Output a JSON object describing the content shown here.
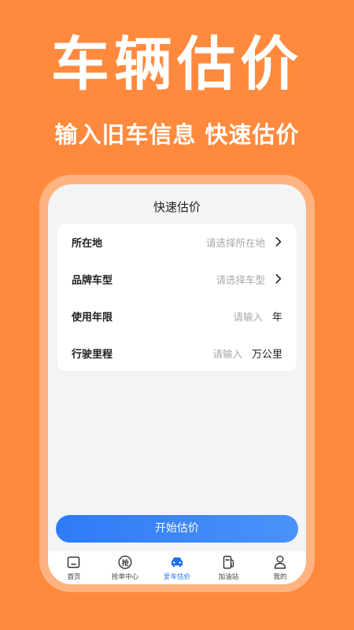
{
  "hero": {
    "title": "车辆估价",
    "subtitle": "输入旧车信息 快速估价"
  },
  "page": {
    "title": "快速估价"
  },
  "form": {
    "rows": [
      {
        "label": "所在地",
        "placeholder": "请选择所在地",
        "trailing": "chevron-right-icon"
      },
      {
        "label": "品牌车型",
        "placeholder": "请选择车型",
        "trailing": "chevron-right-icon"
      },
      {
        "label": "使用年限",
        "placeholder": "请输入",
        "suffix": "年"
      },
      {
        "label": "行驶里程",
        "placeholder": "请输入",
        "suffix": "万公里"
      }
    ]
  },
  "actions": {
    "start_label": "开始估价"
  },
  "tabbar": {
    "items": [
      {
        "label": "首页",
        "icon": "home-icon"
      },
      {
        "label": "抢单中心",
        "icon": "grab-order-icon",
        "icon_text": "抢"
      },
      {
        "label": "爱车估价",
        "icon": "car-icon",
        "active": true
      },
      {
        "label": "加油站",
        "icon": "fuel-pump-icon"
      },
      {
        "label": "我的",
        "icon": "user-icon"
      }
    ]
  },
  "colors": {
    "background": "#FF8A3D",
    "accent": "#2F7BF7",
    "active_tab": "#1F6FEA"
  }
}
